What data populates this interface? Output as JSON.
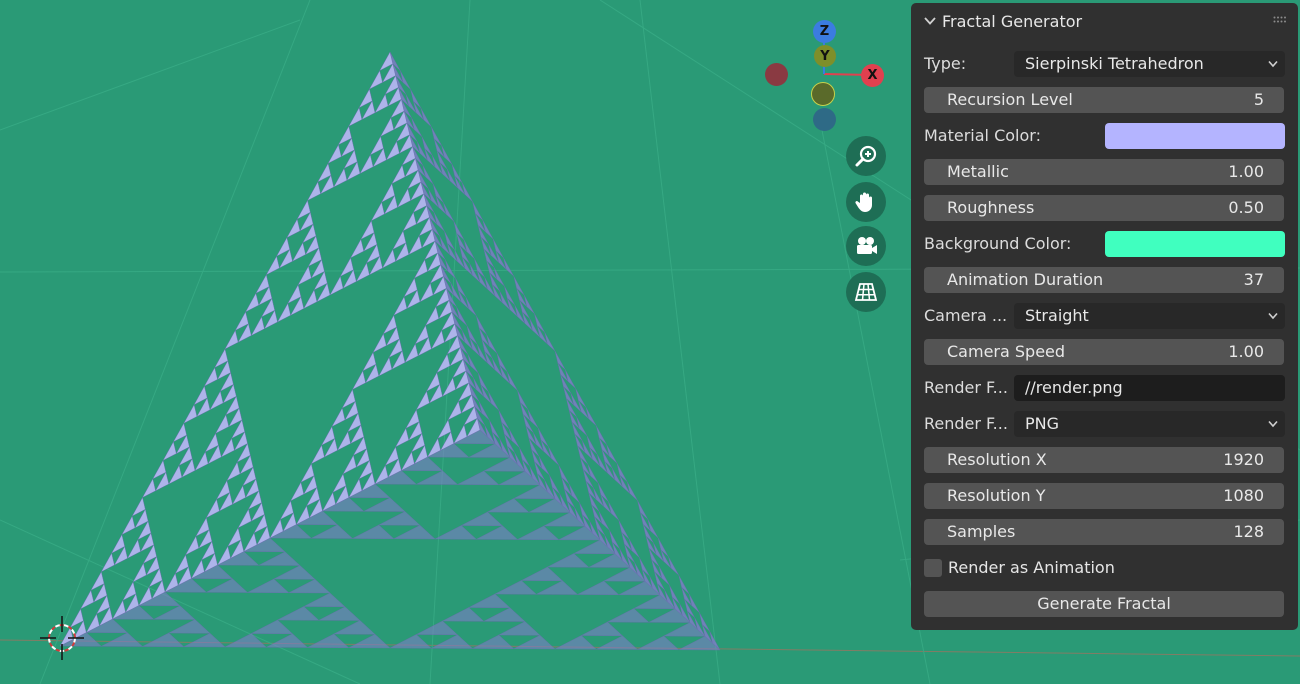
{
  "colors": {
    "viewport_bg": "#2a9a76",
    "fractal_light": "#b4b5f0",
    "fractal_shade": "#7d7ec6",
    "material_color": "#b4b4ff",
    "background_color": "#40ffbf",
    "gizmo_x": "#e0404f",
    "gizmo_y": "#7e8f2a",
    "gizmo_z": "#3b7ce0"
  },
  "gizmo": {
    "x": "X",
    "y": "Y",
    "z": "Z"
  },
  "nav_icons": [
    "zoom-icon",
    "hand-pan-icon",
    "camera-icon",
    "grid-perspective-icon"
  ],
  "panel": {
    "title": "Fractal Generator",
    "type_label": "Type:",
    "type_value": "Sierpinski Tetrahedron",
    "recursion_label": "Recursion Level",
    "recursion_value": "5",
    "material_color_label": "Material Color:",
    "metallic_label": "Metallic",
    "metallic_value": "1.00",
    "roughness_label": "Roughness",
    "roughness_value": "0.50",
    "background_color_label": "Background Color:",
    "anim_duration_label": "Animation Duration",
    "anim_duration_value": "37",
    "camera_label": "Camera ...",
    "camera_value": "Straight",
    "camera_speed_label": "Camera Speed",
    "camera_speed_value": "1.00",
    "render_file_label": "Render F...",
    "render_file_value": "//render.png",
    "render_format_label": "Render F...",
    "render_format_value": "PNG",
    "res_x_label": "Resolution X",
    "res_x_value": "1920",
    "res_y_label": "Resolution Y",
    "res_y_value": "1080",
    "samples_label": "Samples",
    "samples_value": "128",
    "animation_checkbox_label": "Render as Animation",
    "animation_checked": false,
    "generate_label": "Generate Fractal"
  }
}
